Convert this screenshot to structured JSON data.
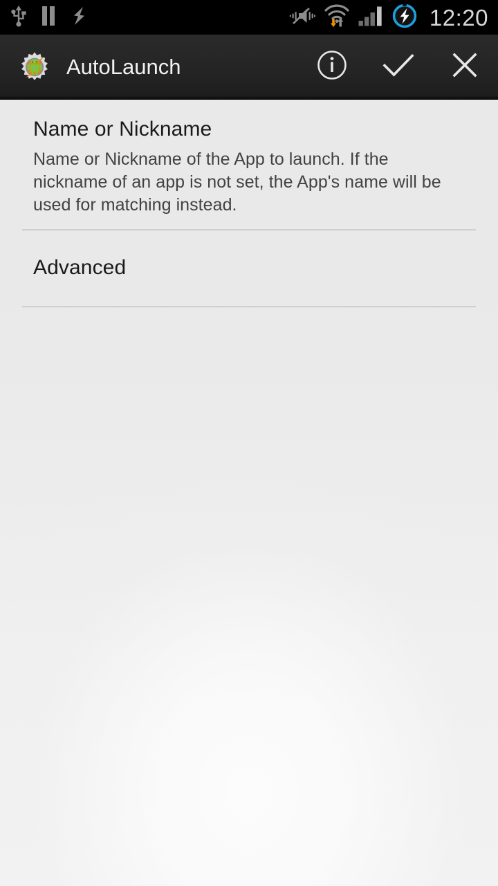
{
  "status_bar": {
    "icons_left": [
      {
        "name": "usb-icon",
        "label": "USB connected"
      },
      {
        "name": "pause-icon",
        "label": "Paused"
      },
      {
        "name": "lightning-icon",
        "label": "Charging"
      }
    ],
    "icons_right": [
      {
        "name": "vibrate-off-icon",
        "label": "Silent / vibrate off"
      },
      {
        "name": "wifi-transfer-icon",
        "label": "Wi-Fi with data transfer"
      },
      {
        "name": "signal-bars-icon",
        "label": "Mobile signal 4 bars"
      },
      {
        "name": "battery-charging-icon",
        "label": "Battery charging"
      }
    ],
    "clock": "12:20",
    "colors": {
      "background": "#000000",
      "icon": "#8c8c8c",
      "clock": "#d8d8d8",
      "accent_download": "#f29100",
      "accent_battery_ring": "#1e9fe0"
    }
  },
  "action_bar": {
    "app_icon": "tasker-gear-android-icon",
    "title": "AutoLaunch",
    "buttons": [
      {
        "name": "info-button",
        "icon": "info-circle-icon",
        "label": "Info"
      },
      {
        "name": "accept-button",
        "icon": "check-icon",
        "label": "Accept"
      },
      {
        "name": "cancel-button",
        "icon": "close-icon",
        "label": "Cancel"
      }
    ],
    "colors": {
      "background": "#252525",
      "title": "#f2f2f2",
      "icon": "#e8e8e8"
    }
  },
  "content": {
    "preferences": [
      {
        "name": "name-or-nickname",
        "title": "Name or Nickname",
        "summary": "Name or Nickname of the App to launch. If the nickname of an app is not set, the App's name will be used for matching instead."
      }
    ],
    "section_header": {
      "name": "advanced",
      "title": "Advanced"
    },
    "colors": {
      "background": "#e9e9e9",
      "title": "#1a1a1a",
      "summary": "#424242",
      "divider": "#cfcfcf"
    }
  }
}
